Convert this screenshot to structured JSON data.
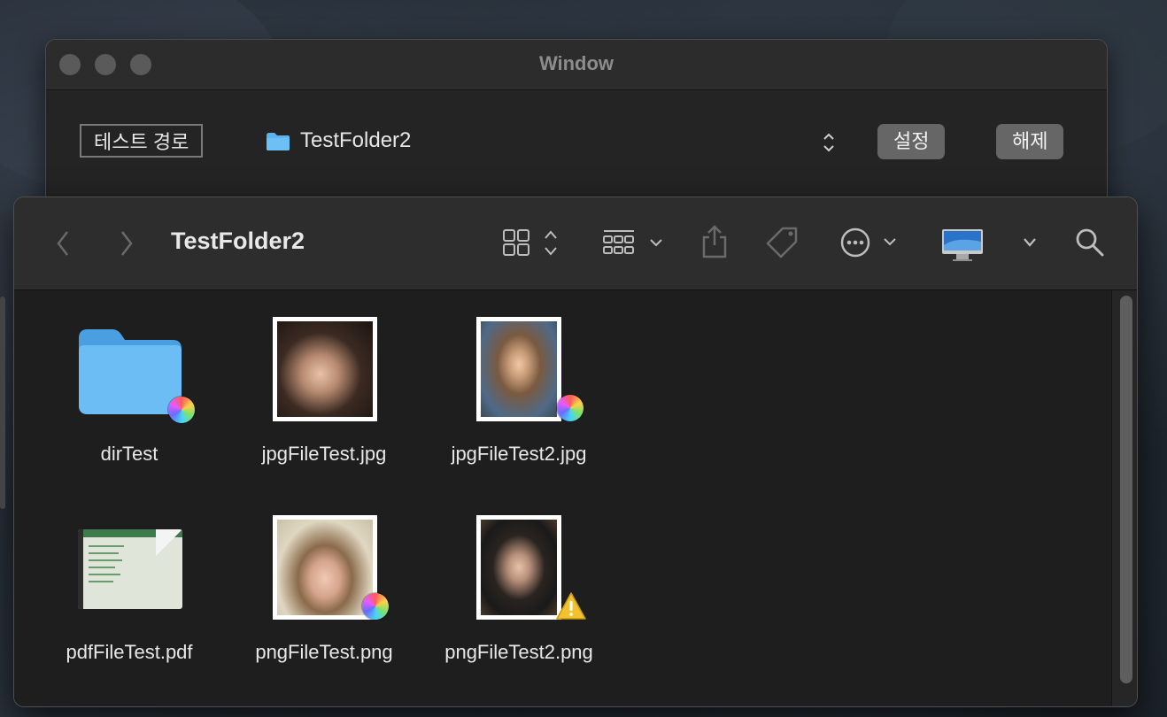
{
  "back_window": {
    "title": "Window",
    "path_label": "테스트 경로",
    "path_value": "TestFolder2",
    "stepper_icon": "up-down-chevron",
    "set_button": "설정",
    "clear_button": "해제"
  },
  "finder": {
    "title": "TestFolder2",
    "toolbar_icons": [
      "back-chevron",
      "forward-chevron",
      "icon-view-grid",
      "group-by-grid",
      "share",
      "tag",
      "more-ellipsis",
      "computer-imac",
      "chevron-down",
      "search"
    ]
  },
  "files": [
    {
      "name": "dirTest",
      "kind": "folder",
      "badge": "color-wheel"
    },
    {
      "name": "jpgFileTest.jpg",
      "kind": "image",
      "badge": ""
    },
    {
      "name": "jpgFileTest2.jpg",
      "kind": "image",
      "badge": "color-wheel"
    },
    {
      "name": "pdfFileTest.pdf",
      "kind": "pdf",
      "badge": ""
    },
    {
      "name": "pngFileTest.png",
      "kind": "image",
      "badge": "color-wheel"
    },
    {
      "name": "pngFileTest2.png",
      "kind": "image",
      "badge": "warning"
    }
  ],
  "colors": {
    "folder_blue": "#5cb3f0",
    "window_bg": "#1e1e1e",
    "toolbar_bg": "#2d2d2d",
    "warning_yellow": "#f2c230"
  }
}
